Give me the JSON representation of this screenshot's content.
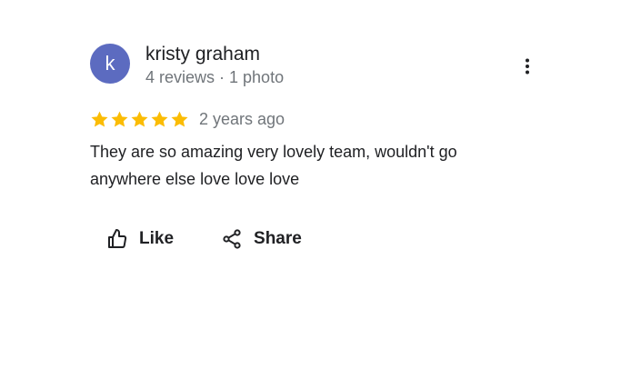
{
  "review": {
    "avatar_letter": "k",
    "avatar_color": "#5c6bc0",
    "author_name": "kristy graham",
    "author_meta": "4 reviews · 1 photo",
    "rating": 5,
    "rating_max": 5,
    "star_color": "#fbbc04",
    "date": "2 years ago",
    "text": "They are so amazing very lovely team, wouldn't go anywhere else love love love",
    "more_icon": "more-vert-icon"
  },
  "actions": {
    "like_label": "Like",
    "like_icon": "thumb-up-icon",
    "share_label": "Share",
    "share_icon": "share-icon"
  }
}
